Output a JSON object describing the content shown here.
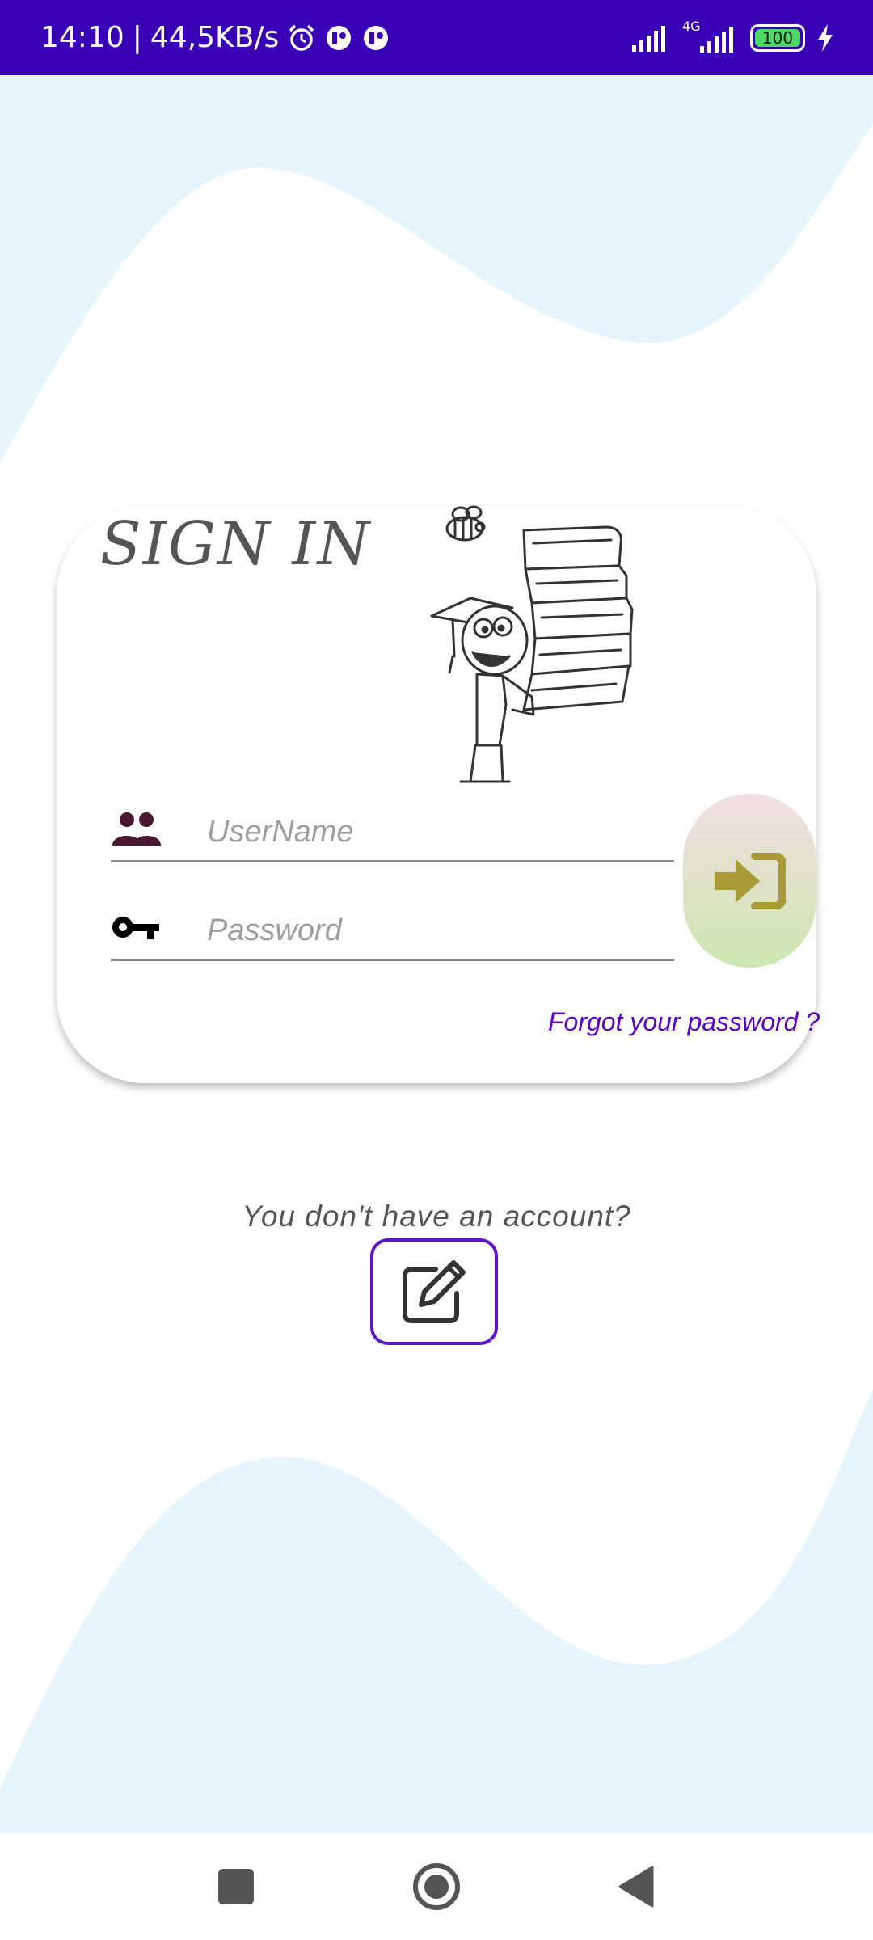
{
  "status_bar": {
    "time": "14:10",
    "separator": "|",
    "network_speed": "44,5KB/s",
    "icons": [
      "alarm-icon",
      "notification-icon",
      "notification-icon"
    ],
    "network_type": "4G",
    "battery_level": "100",
    "charging": true
  },
  "card": {
    "title": "SIGN IN",
    "illustration": "student-with-books"
  },
  "form": {
    "username_placeholder": "UserName",
    "password_placeholder": "Password",
    "username_value": "",
    "password_value": "",
    "username_icon": "users-icon",
    "password_icon": "key-icon",
    "forgot_label": "Forgot your password ?",
    "login_icon": "sign-in-icon"
  },
  "signup": {
    "prompt": "You don't have an account?",
    "icon": "edit-icon"
  },
  "nav": {
    "items": [
      "recents",
      "home",
      "back"
    ]
  },
  "colors": {
    "status_bar": "#3A00B5",
    "background": "#E6F4FD",
    "wave": "#FFFFFF",
    "accent": "#5B00C9",
    "login_icon": "#A89A35",
    "user_icon": "#4A1830"
  }
}
